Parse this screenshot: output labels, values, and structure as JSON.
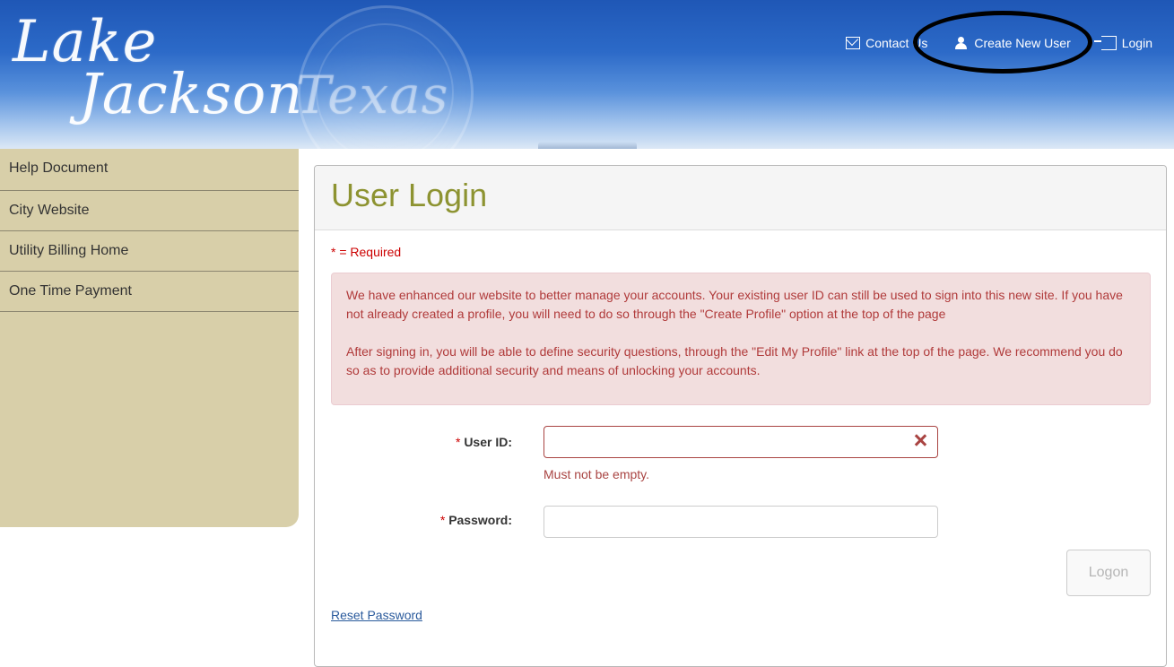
{
  "header": {
    "logo_text": "Lake Jackson Texas",
    "logo_lake": "Lake",
    "logo_jackson": "Jackson",
    "logo_texas": "Texas",
    "nav": [
      {
        "label": "Contact Us",
        "icon": "envelope-icon"
      },
      {
        "label": "Create New User",
        "icon": "user-icon"
      },
      {
        "label": "Login",
        "icon": "login-icon"
      }
    ],
    "highlighted_item": "Create New User"
  },
  "sidebar": {
    "items": [
      {
        "label": "Help Document"
      },
      {
        "label": "City Website"
      },
      {
        "label": "Utility Billing Home"
      },
      {
        "label": "One Time Payment"
      }
    ]
  },
  "main": {
    "title": "User Login",
    "required_note": "* = Required",
    "alert": {
      "paragraph1": "We have enhanced our website to better manage your accounts. Your existing user ID can still be used to sign into this new site. If you have not already created a profile, you will need to do so through the \"Create Profile\" option at the top of the page",
      "paragraph2": "After signing in, you will be able to define security questions, through the \"Edit My Profile\" link at the top of the page. We recommend you do so as to provide additional security and means of unlocking your accounts."
    },
    "form": {
      "required_marker": "*",
      "user_id_label": "User ID:",
      "user_id_value": "",
      "user_id_error": "Must not be empty.",
      "password_label": "Password:",
      "password_value": "",
      "logon_button": "Logon",
      "reset_link": "Reset Password"
    }
  },
  "colors": {
    "header_blue": "#2c6ac8",
    "sidebar_bg": "#d8cfa9",
    "title_olive": "#8d9331",
    "alert_bg": "#f2dede",
    "alert_text": "#b03a3a",
    "error_red": "#a94442",
    "link_blue": "#2a5a9c"
  }
}
